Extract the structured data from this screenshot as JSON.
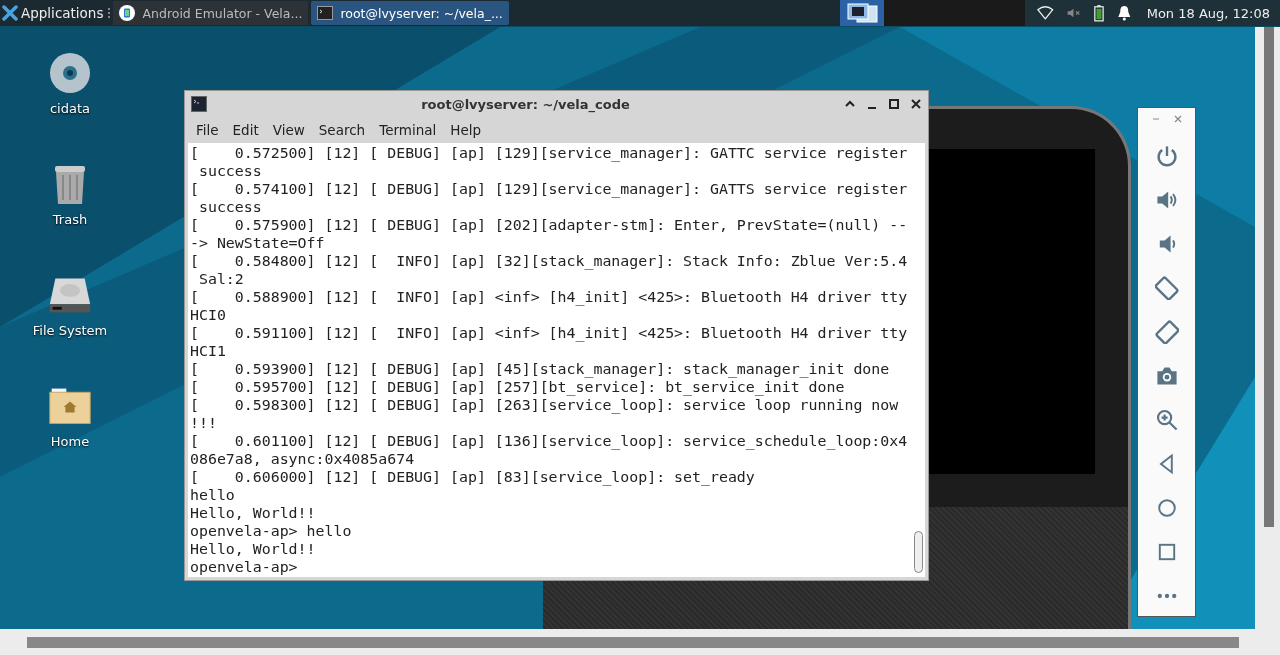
{
  "taskbar": {
    "applications_label": "Applications",
    "tasks": [
      {
        "title": "Android Emulator - Vela...",
        "kind": "emulator",
        "selected": false
      },
      {
        "title": "root@lvyserver: ~/vela_...",
        "kind": "terminal",
        "selected": true
      }
    ],
    "clock": "Mon 18 Aug, 12:08"
  },
  "desktop_icons": [
    {
      "label": "cidata",
      "kind": "disc"
    },
    {
      "label": "Trash",
      "kind": "trash"
    },
    {
      "label": "File System",
      "kind": "drive"
    },
    {
      "label": "Home",
      "kind": "folder"
    }
  ],
  "terminal": {
    "title": "root@lvyserver: ~/vela_code",
    "menu": [
      "File",
      "Edit",
      "View",
      "Search",
      "Terminal",
      "Help"
    ],
    "lines": [
      "[    0.572500] [12] [ DEBUG] [ap] [129][service_manager]: GATTC service register",
      " success",
      "[    0.574100] [12] [ DEBUG] [ap] [129][service_manager]: GATTS service register",
      " success",
      "[    0.575900] [12] [ DEBUG] [ap] [202][adapter-stm]: Enter, PrevState=(null) --",
      "-> NewState=Off",
      "[    0.584800] [12] [  INFO] [ap] [32][stack_manager]: Stack Info: Zblue Ver:5.4",
      " Sal:2",
      "[    0.588900] [12] [  INFO] [ap] <inf> [h4_init] <425>: Bluetooth H4 driver tty",
      "HCI0",
      "[    0.591100] [12] [  INFO] [ap] <inf> [h4_init] <425>: Bluetooth H4 driver tty",
      "HCI1",
      "[    0.593900] [12] [ DEBUG] [ap] [45][stack_manager]: stack_manager_init done",
      "[    0.595700] [12] [ DEBUG] [ap] [257][bt_service]: bt_service_init done",
      "[    0.598300] [12] [ DEBUG] [ap] [263][service_loop]: service loop running now",
      "!!!",
      "[    0.601100] [12] [ DEBUG] [ap] [136][service_loop]: service_schedule_loop:0x4",
      "086e7a8, async:0x4085a674",
      "[    0.606000] [12] [ DEBUG] [ap] [83][service_loop]: set_ready",
      "hello",
      "Hello, World!!",
      "openvela-ap> hello",
      "Hello, World!!",
      "openvela-ap>"
    ]
  }
}
